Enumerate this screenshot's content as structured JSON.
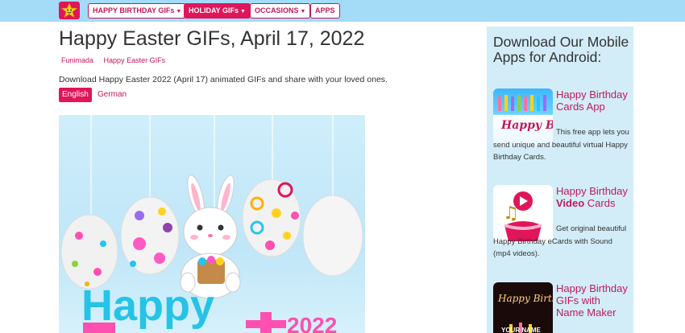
{
  "nav": {
    "logo": "star-logo-icon",
    "items": [
      {
        "label": "HAPPY BIRTHDAY GIFs",
        "dropdown": true,
        "active": false
      },
      {
        "label": "HOLIDAY GIFs",
        "dropdown": true,
        "active": true
      },
      {
        "label": "OCCASIONS",
        "dropdown": true,
        "active": false
      },
      {
        "label": "APPS",
        "dropdown": false,
        "active": false
      }
    ]
  },
  "page": {
    "title": "Happy Easter GIFs, April 17, 2022",
    "breadcrumbs": [
      "Funimada",
      "Happy Easter GIFs"
    ],
    "description": "Download Happy Easter 2022 (April 17) animated GIFs and share with your loved ones.",
    "languages": [
      {
        "label": "English",
        "active": true
      },
      {
        "label": "German",
        "active": false
      }
    ]
  },
  "hero": {
    "text_happy": "Happy",
    "text_year": "2022"
  },
  "sidebar": {
    "title": "Download Our Mobile Apps for Android:",
    "apps": [
      {
        "name": "Happy Birthday Cards App",
        "name_bold": "",
        "description": "This free app lets you send unique and beautiful virtual Happy Birthday Cards.",
        "thumb_text": "Happy Birthday"
      },
      {
        "name_pre": "Happy Birthday",
        "name_bold": "Video",
        "name_post": "Cards",
        "description": "Get original beautiful Happy Birthday eCards with Sound (mp4 videos)."
      },
      {
        "name": "Happy Birthday GIFs with Name Maker",
        "thumb_text": "Happy Birthday",
        "thumb_sub": "YOUR NAME"
      }
    ]
  },
  "colors": {
    "topbar": "#a4dbf7",
    "accent": "#e0155a",
    "link": "#c2185b",
    "sidebar_bg": "#d3edf8"
  }
}
